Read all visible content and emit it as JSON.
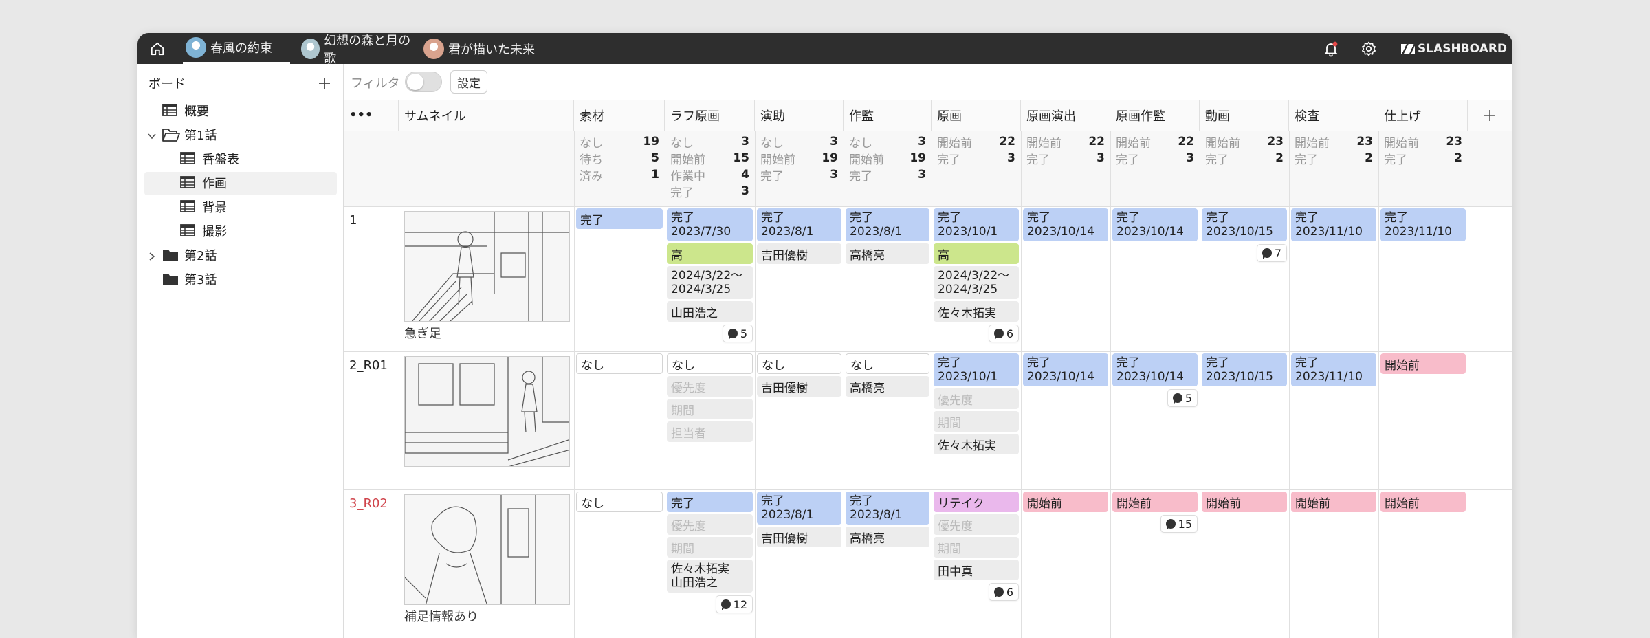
{
  "colors": {
    "topbar": "#2e2e2e",
    "done": "#bcd0f5",
    "not_started": "#f8bcca",
    "retake": "#eab8ec",
    "priority_high": "#cce68c",
    "row3_name": "#d0454c"
  },
  "tabs": [
    {
      "label": "春風の約束",
      "avatar": "#7fb3d5"
    },
    {
      "label": "幻想の森と月の歌",
      "avatar": "#aec6cf"
    },
    {
      "label": "君が描いた未来",
      "avatar": "#d9a38e"
    }
  ],
  "brand": "SLASHBOARD",
  "icons": [
    "home-icon",
    "bell-icon",
    "gear-icon",
    "slashboard-logo-icon",
    "plus-icon",
    "table-icon",
    "folder-icon",
    "chevron-icon",
    "more-icon",
    "comment-icon"
  ],
  "sidebar": {
    "title": "ボード",
    "tree": [
      {
        "label": "概要",
        "type": "table",
        "depth": 1
      },
      {
        "label": "第1話",
        "type": "folder-open",
        "depth": 1,
        "expanded": true
      },
      {
        "label": "香盤表",
        "type": "table",
        "depth": 2
      },
      {
        "label": "作画",
        "type": "table",
        "depth": 2,
        "selected": true
      },
      {
        "label": "背景",
        "type": "table",
        "depth": 2
      },
      {
        "label": "撮影",
        "type": "table",
        "depth": 2
      },
      {
        "label": "第2話",
        "type": "folder",
        "depth": 1,
        "expanded": false
      },
      {
        "label": "第3話",
        "type": "folder",
        "depth": 1
      }
    ]
  },
  "toolbar": {
    "filter_label": "フィルタ",
    "filter_on": false,
    "settings_label": "設定"
  },
  "table": {
    "more": "•••",
    "thumb_header": "サムネイル",
    "columns": [
      "素材",
      "ラフ原画",
      "演助",
      "作監",
      "原画",
      "原画演出",
      "原画作監",
      "動画",
      "検査",
      "仕上げ"
    ],
    "summary": [
      [
        [
          "なし",
          "19"
        ],
        [
          "待ち",
          "5"
        ],
        [
          "済み",
          "1"
        ]
      ],
      [
        [
          "なし",
          "3"
        ],
        [
          "開始前",
          "15"
        ],
        [
          "作業中",
          "4"
        ],
        [
          "完了",
          "3"
        ]
      ],
      [
        [
          "なし",
          "3"
        ],
        [
          "開始前",
          "19"
        ],
        [
          "完了",
          "3"
        ]
      ],
      [
        [
          "なし",
          "3"
        ],
        [
          "開始前",
          "19"
        ],
        [
          "完了",
          "3"
        ]
      ],
      [
        [
          "開始前",
          "22"
        ],
        [
          "完了",
          "3"
        ]
      ],
      [
        [
          "開始前",
          "22"
        ],
        [
          "完了",
          "3"
        ]
      ],
      [
        [
          "開始前",
          "22"
        ],
        [
          "完了",
          "3"
        ]
      ],
      [
        [
          "開始前",
          "23"
        ],
        [
          "完了",
          "2"
        ]
      ],
      [
        [
          "開始前",
          "23"
        ],
        [
          "完了",
          "2"
        ]
      ],
      [
        [
          "開始前",
          "23"
        ],
        [
          "完了",
          "2"
        ]
      ]
    ],
    "rows": [
      {
        "name": "1",
        "name_alert": false,
        "caption": "急ぎ足",
        "cells": [
          [
            {
              "k": "done",
              "t": [
                "完了"
              ]
            }
          ],
          [
            {
              "k": "done",
              "t": [
                "完了",
                "2023/7/30"
              ]
            },
            {
              "k": "high",
              "t": [
                "高"
              ]
            },
            {
              "k": "grey",
              "t": [
                "2024/3/22〜",
                "2024/3/25"
              ]
            },
            {
              "k": "grey",
              "t": [
                "山田浩之"
              ]
            },
            {
              "k": "cmt",
              "t": [
                "5"
              ]
            }
          ],
          [
            {
              "k": "done",
              "t": [
                "完了",
                "2023/8/1"
              ]
            },
            {
              "k": "grey",
              "t": [
                "吉田優樹"
              ]
            }
          ],
          [
            {
              "k": "done",
              "t": [
                "完了",
                "2023/8/1"
              ]
            },
            {
              "k": "grey",
              "t": [
                "高橋亮"
              ]
            }
          ],
          [
            {
              "k": "done",
              "t": [
                "完了",
                "2023/10/1"
              ]
            },
            {
              "k": "high",
              "t": [
                "高"
              ]
            },
            {
              "k": "grey",
              "t": [
                "2024/3/22〜",
                "2024/3/25"
              ]
            },
            {
              "k": "grey",
              "t": [
                "佐々木拓実"
              ]
            },
            {
              "k": "cmt",
              "t": [
                "6"
              ]
            }
          ],
          [
            {
              "k": "done",
              "t": [
                "完了",
                "2023/10/14"
              ]
            }
          ],
          [
            {
              "k": "done",
              "t": [
                "完了",
                "2023/10/14"
              ]
            }
          ],
          [
            {
              "k": "done",
              "t": [
                "完了",
                "2023/10/15"
              ]
            },
            {
              "k": "cmt",
              "t": [
                "7"
              ]
            }
          ],
          [
            {
              "k": "done",
              "t": [
                "完了",
                "2023/11/10"
              ]
            }
          ],
          [
            {
              "k": "done",
              "t": [
                "完了",
                "2023/11/10"
              ]
            }
          ]
        ]
      },
      {
        "name": "2_R01",
        "name_alert": false,
        "caption": "",
        "cells": [
          [
            {
              "k": "none",
              "t": [
                "なし"
              ]
            }
          ],
          [
            {
              "k": "none",
              "t": [
                "なし"
              ]
            },
            {
              "k": "ph",
              "t": [
                "優先度"
              ]
            },
            {
              "k": "ph",
              "t": [
                "期間"
              ]
            },
            {
              "k": "ph",
              "t": [
                "担当者"
              ]
            }
          ],
          [
            {
              "k": "none",
              "t": [
                "なし"
              ]
            },
            {
              "k": "grey",
              "t": [
                "吉田優樹"
              ]
            }
          ],
          [
            {
              "k": "none",
              "t": [
                "なし"
              ]
            },
            {
              "k": "grey",
              "t": [
                "高橋亮"
              ]
            }
          ],
          [
            {
              "k": "done",
              "t": [
                "完了",
                "2023/10/1"
              ]
            },
            {
              "k": "ph",
              "t": [
                "優先度"
              ]
            },
            {
              "k": "ph",
              "t": [
                "期間"
              ]
            },
            {
              "k": "grey",
              "t": [
                "佐々木拓実"
              ]
            }
          ],
          [
            {
              "k": "done",
              "t": [
                "完了",
                "2023/10/14"
              ]
            }
          ],
          [
            {
              "k": "done",
              "t": [
                "完了",
                "2023/10/14"
              ]
            },
            {
              "k": "cmt",
              "t": [
                "5"
              ]
            }
          ],
          [
            {
              "k": "done",
              "t": [
                "完了",
                "2023/10/15"
              ]
            }
          ],
          [
            {
              "k": "done",
              "t": [
                "完了",
                "2023/11/10"
              ]
            }
          ],
          [
            {
              "k": "pre",
              "t": [
                "開始前"
              ]
            }
          ]
        ]
      },
      {
        "name": "3_R02",
        "name_alert": true,
        "caption": "補足情報あり",
        "cells": [
          [
            {
              "k": "none",
              "t": [
                "なし"
              ]
            }
          ],
          [
            {
              "k": "done",
              "t": [
                "完了"
              ]
            },
            {
              "k": "ph",
              "t": [
                "優先度"
              ]
            },
            {
              "k": "ph",
              "t": [
                "期間"
              ]
            },
            {
              "k": "grey",
              "t": [
                "佐々木拓実",
                "山田浩之"
              ]
            },
            {
              "k": "cmt",
              "t": [
                "12"
              ]
            }
          ],
          [
            {
              "k": "done",
              "t": [
                "完了",
                "2023/8/1"
              ]
            },
            {
              "k": "grey",
              "t": [
                "吉田優樹"
              ]
            }
          ],
          [
            {
              "k": "done",
              "t": [
                "完了",
                "2023/8/1"
              ]
            },
            {
              "k": "grey",
              "t": [
                "高橋亮"
              ]
            }
          ],
          [
            {
              "k": "retake",
              "t": [
                "リテイク"
              ]
            },
            {
              "k": "ph",
              "t": [
                "優先度"
              ]
            },
            {
              "k": "ph",
              "t": [
                "期間"
              ]
            },
            {
              "k": "grey",
              "t": [
                "田中真"
              ]
            },
            {
              "k": "cmt",
              "t": [
                "6"
              ]
            }
          ],
          [
            {
              "k": "pre",
              "t": [
                "開始前"
              ]
            }
          ],
          [
            {
              "k": "pre",
              "t": [
                "開始前"
              ]
            },
            {
              "k": "cmt",
              "t": [
                "15"
              ]
            }
          ],
          [
            {
              "k": "pre",
              "t": [
                "開始前"
              ]
            }
          ],
          [
            {
              "k": "pre",
              "t": [
                "開始前"
              ]
            }
          ],
          [
            {
              "k": "pre",
              "t": [
                "開始前"
              ]
            }
          ]
        ]
      }
    ]
  }
}
